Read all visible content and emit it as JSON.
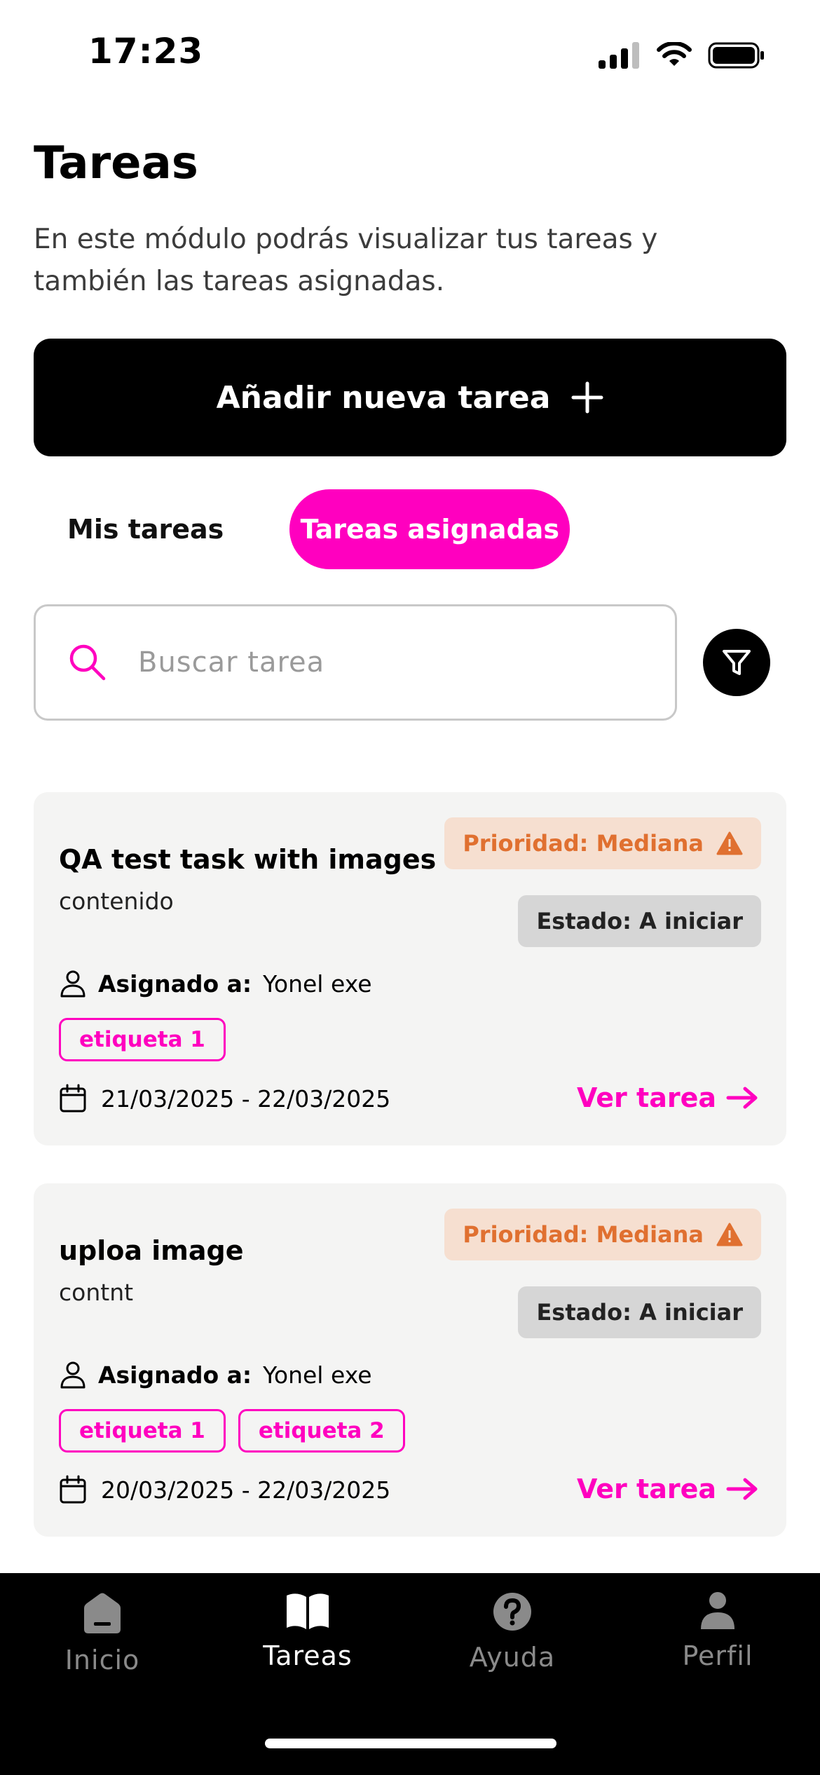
{
  "status_bar": {
    "time": "17:23",
    "icons": [
      "signal-icon",
      "wifi-icon",
      "battery-icon"
    ]
  },
  "header": {
    "title": "Tareas",
    "description": "En este módulo podrás visualizar tus tareas y también las tareas asignadas."
  },
  "add_button": {
    "label": "Añadir nueva tarea",
    "icon": "plus-icon"
  },
  "tabs": [
    {
      "label": "Mis tareas",
      "active": false
    },
    {
      "label": "Tareas asignadas",
      "active": true
    }
  ],
  "search": {
    "placeholder": "Buscar tarea",
    "value": ""
  },
  "colors": {
    "accent": "#ff00bf",
    "priority_text": "#e07030",
    "priority_bg": "#f6dfd0",
    "status_bg": "#d6d6d6",
    "card_bg": "#f4f4f3"
  },
  "tasks": [
    {
      "title": "QA test task with images",
      "content": "contenido",
      "priority": "Prioridad: Mediana",
      "status": "Estado: A iniciar",
      "assigned_label": "Asignado a:",
      "assigned_to": "Yonel exe",
      "tags": [
        "etiqueta 1"
      ],
      "dates": "21/03/2025 - 22/03/2025",
      "view_label": "Ver tarea"
    },
    {
      "title": "uploa image",
      "content": "contnt",
      "priority": "Prioridad: Mediana",
      "status": "Estado: A iniciar",
      "assigned_label": "Asignado a:",
      "assigned_to": "Yonel exe",
      "tags": [
        "etiqueta 1",
        "etiqueta 2"
      ],
      "dates": "20/03/2025 - 22/03/2025",
      "view_label": "Ver tarea"
    }
  ],
  "bottom_nav": [
    {
      "label": "Inicio",
      "icon": "home-icon",
      "active": false
    },
    {
      "label": "Tareas",
      "icon": "book-icon",
      "active": true
    },
    {
      "label": "Ayuda",
      "icon": "help-icon",
      "active": false
    },
    {
      "label": "Perfil",
      "icon": "user-icon",
      "active": false
    }
  ]
}
